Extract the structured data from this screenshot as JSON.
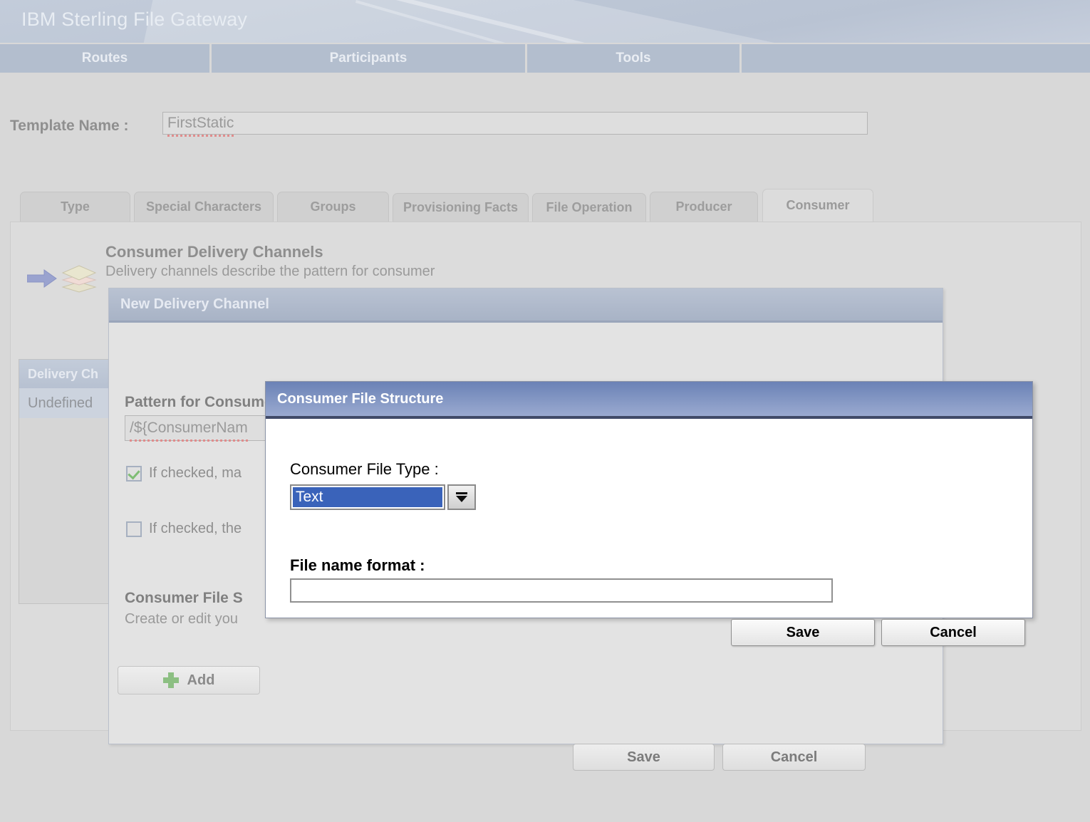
{
  "app": {
    "title": "IBM Sterling File Gateway"
  },
  "nav": {
    "items": [
      {
        "label": "Routes"
      },
      {
        "label": "Participants"
      },
      {
        "label": "Tools"
      }
    ]
  },
  "template": {
    "label": "Template Name :",
    "value": "FirstStatic",
    "placeholder": ""
  },
  "tabs": [
    {
      "label": "Type",
      "active": false
    },
    {
      "label": "Special Characters",
      "active": false
    },
    {
      "label": "Groups",
      "active": false
    },
    {
      "label": "Provisioning Facts",
      "active": false
    },
    {
      "label": "File Operation",
      "active": false
    },
    {
      "label": "Producer",
      "active": false
    },
    {
      "label": "Consumer",
      "active": true
    }
  ],
  "consumer_panel": {
    "section_title": "Consumer Delivery Channels",
    "section_desc": "Delivery channels describe the pattern for consumer",
    "arrow_icon": "arrow-right-icon",
    "stack_icon": "layers-stack-icon",
    "table": {
      "header": "Delivery Ch",
      "rows": [
        "Undefined"
      ]
    }
  },
  "new_delivery_channel_dialog": {
    "title": "New Delivery Channel",
    "pattern_label": "Pattern for Consumer Mailbox Path :",
    "pattern_value": "/${ConsumerNam",
    "checkbox_1": {
      "label": "If checked, ma",
      "checked": true
    },
    "checkbox_2": {
      "label": "If checked, the",
      "checked": false
    },
    "cfs_title": "Consumer File S",
    "cfs_desc": "Create or edit you",
    "add_label": "Add",
    "add_icon": "plus-icon",
    "save_label": "Save",
    "cancel_label": "Cancel"
  },
  "consumer_file_structure_dialog": {
    "title": "Consumer File Structure",
    "file_type_label": "Consumer File Type :",
    "file_type_value": "Text",
    "file_type_options": [
      "Text"
    ],
    "file_name_format_label": "File name format :",
    "file_name_format_value": "",
    "file_name_format_placeholder": "",
    "save_label": "Save",
    "cancel_label": "Cancel"
  },
  "colors": {
    "page_background": "#d8d8d8",
    "header_gradient_start": "#c3ccda",
    "nav_tab": "#b3bece",
    "active_modal_title": "#6b82b6",
    "background_modal_title": "#b9c2d2",
    "select_highlight": "#3a63ba",
    "checkbox_check": "#7fbd74",
    "plus_icon": "#8cbf82",
    "spellcheck_underline": "#e08c8c"
  }
}
